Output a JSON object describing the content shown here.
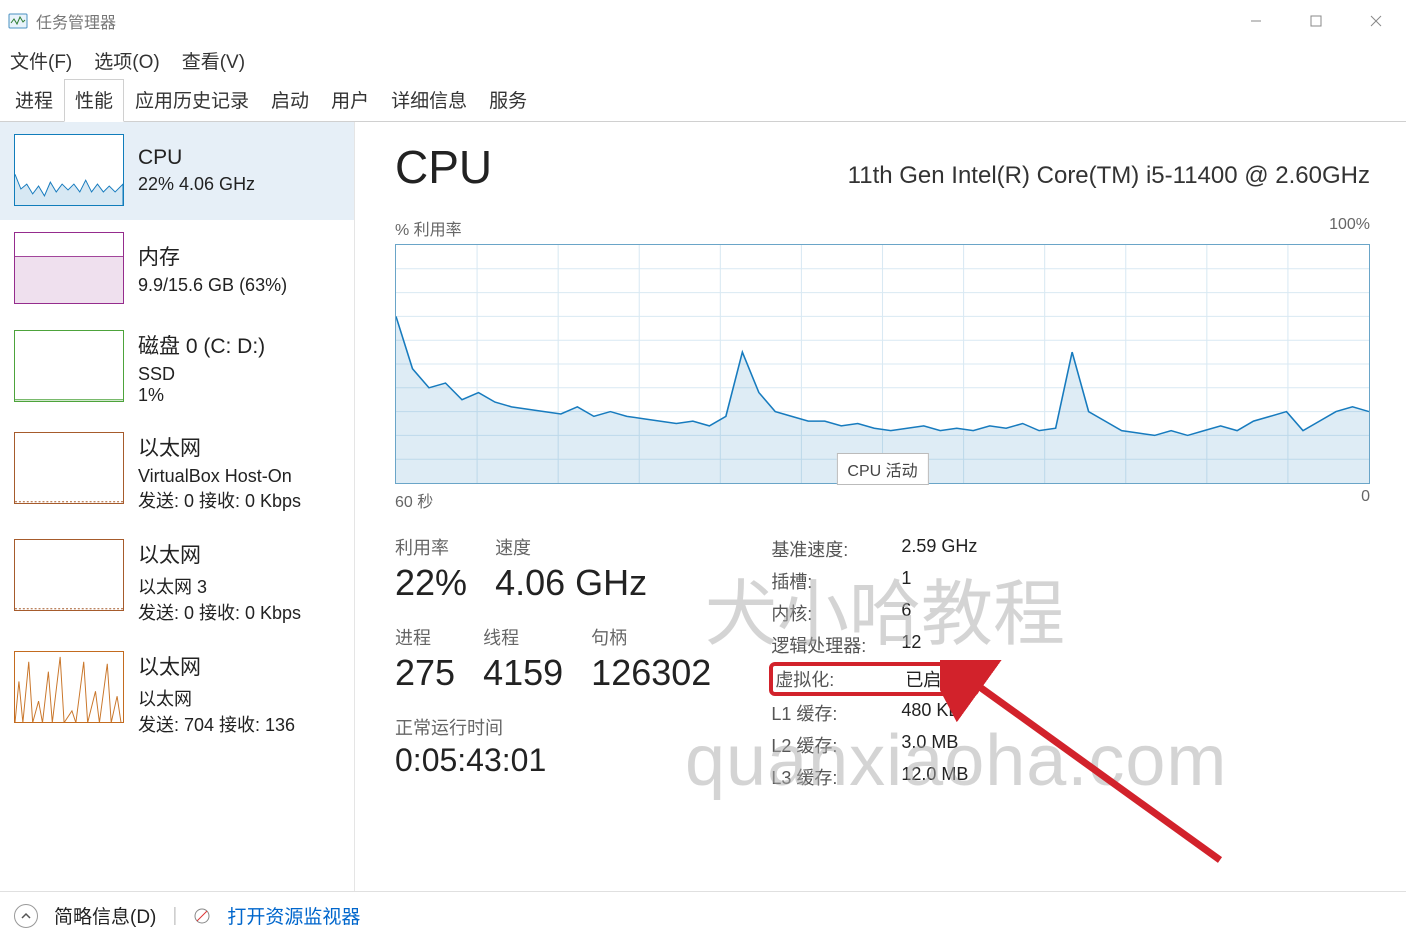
{
  "window_title": "任务管理器",
  "menubar": [
    "文件(F)",
    "选项(O)",
    "查看(V)"
  ],
  "tabs": [
    "进程",
    "性能",
    "应用历史记录",
    "启动",
    "用户",
    "详细信息",
    "服务"
  ],
  "active_tab_index": 1,
  "sidebar": [
    {
      "title": "CPU",
      "sub": "22%  4.06 GHz",
      "type": "cpu",
      "selected": true
    },
    {
      "title": "内存",
      "sub": "9.9/15.6 GB (63%)",
      "type": "mem"
    },
    {
      "title": "磁盘 0 (C: D:)",
      "sub": "SSD",
      "sub2": "1%",
      "type": "disk"
    },
    {
      "title": "以太网",
      "sub": "VirtualBox Host-On",
      "sub2_html": "发送: 0  接收: 0 Kbps",
      "type": "eth"
    },
    {
      "title": "以太网",
      "sub": "以太网 3",
      "sub2_html": "发送: 0  接收: 0 Kbps",
      "type": "eth"
    },
    {
      "title": "以太网",
      "sub": "以太网",
      "sub2_html": "发送: 704  接收: 136",
      "type": "eth-active"
    }
  ],
  "main": {
    "title": "CPU",
    "name": "11th Gen Intel(R) Core(TM) i5-11400 @ 2.60GHz",
    "chart_top_left": "% 利用率",
    "chart_top_right": "100%",
    "chart_tooltip": "CPU 活动",
    "chart_bottom_left": "60 秒",
    "chart_bottom_right": "0",
    "left_stats": {
      "util_label": "利用率",
      "util_val": "22%",
      "speed_label": "速度",
      "speed_val": "4.06 GHz",
      "proc_label": "进程",
      "proc_val": "275",
      "thr_label": "线程",
      "thr_val": "4159",
      "hnd_label": "句柄",
      "hnd_val": "126302",
      "uptime_label": "正常运行时间",
      "uptime_val": "0:05:43:01"
    },
    "right_stats": [
      {
        "k": "基准速度:",
        "v": "2.59 GHz"
      },
      {
        "k": "插槽:",
        "v": "1"
      },
      {
        "k": "内核:",
        "v": "6"
      },
      {
        "k": "逻辑处理器:",
        "v": "12"
      },
      {
        "k": "虚拟化:",
        "v": "已启用",
        "highlight": true
      },
      {
        "k": "L1 缓存:",
        "v": "480 KB"
      },
      {
        "k": "L2 缓存:",
        "v": "3.0 MB"
      },
      {
        "k": "L3 缓存:",
        "v": "12.0 MB"
      }
    ]
  },
  "footer": {
    "brief": "简略信息(D)",
    "resmon": "打开资源监视器"
  },
  "watermarks": {
    "wm1": "犬小哈教程",
    "wm2": "quanxiaoha.com"
  },
  "chart_data": {
    "type": "line",
    "title": "% 利用率",
    "xlabel": "60 秒",
    "ylabel": "% 利用率",
    "ylim": [
      0,
      100
    ],
    "x_seconds": "60..0",
    "values": [
      70,
      48,
      40,
      42,
      35,
      38,
      34,
      32,
      31,
      30,
      29,
      32,
      28,
      30,
      28,
      27,
      26,
      25,
      26,
      24,
      28,
      55,
      38,
      30,
      28,
      26,
      26,
      24,
      25,
      23,
      22,
      23,
      24,
      22,
      23,
      22,
      24,
      23,
      25,
      22,
      23,
      55,
      30,
      26,
      22,
      21,
      20,
      22,
      20,
      22,
      24,
      22,
      26,
      28,
      30,
      22,
      26,
      30,
      32,
      30
    ]
  }
}
